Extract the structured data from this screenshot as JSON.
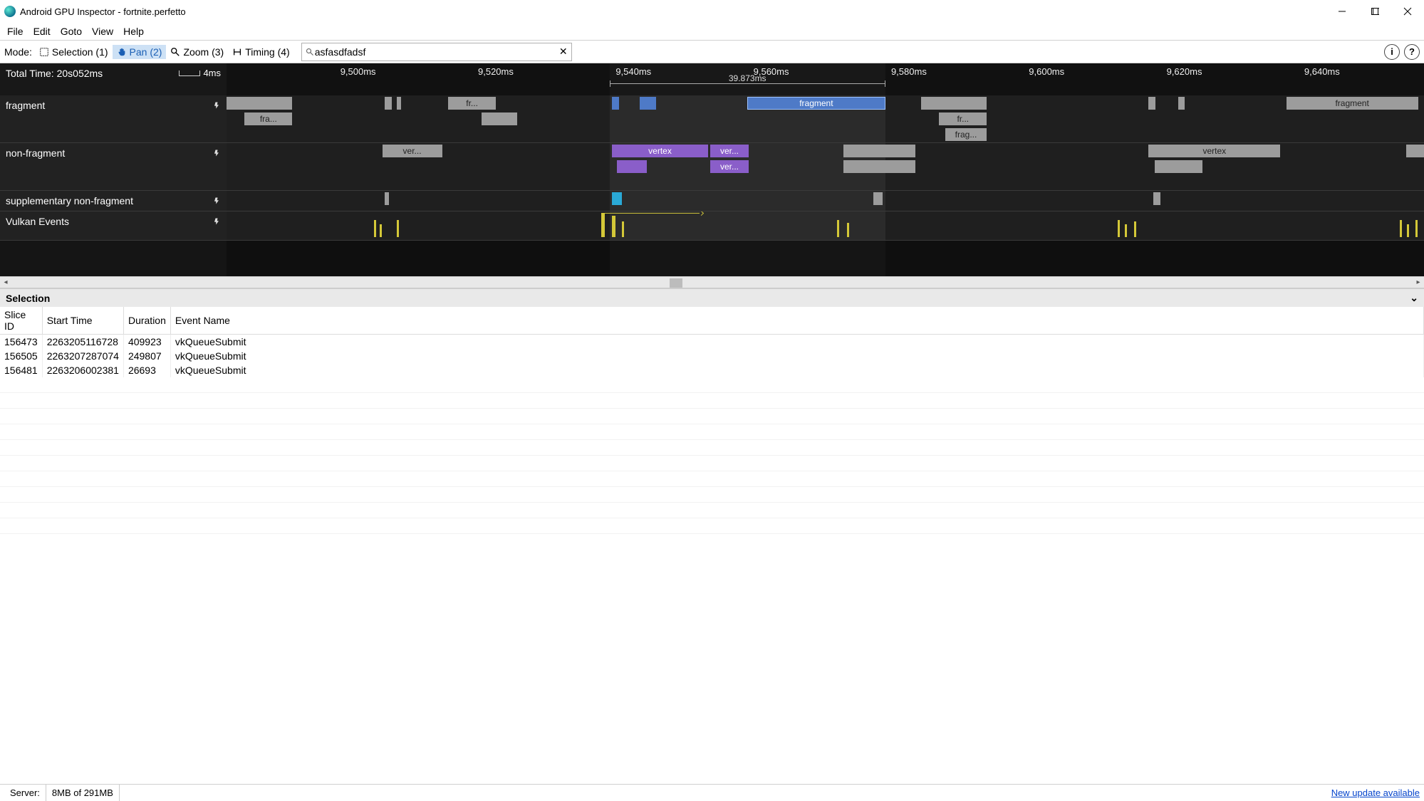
{
  "window": {
    "title": "Android GPU Inspector - fortnite.perfetto"
  },
  "menu": {
    "items": [
      "File",
      "Edit",
      "Goto",
      "View",
      "Help"
    ]
  },
  "toolbar": {
    "mode_label": "Mode:",
    "modes": {
      "selection": "Selection (1)",
      "pan": "Pan (2)",
      "zoom": "Zoom (3)",
      "timing": "Timing (4)"
    },
    "search_value": "asfasdfadsf"
  },
  "timeline": {
    "total_time_label": "Total Time: 20s052ms",
    "scale_label": "4ms",
    "ruler_ticks": [
      "9,500ms",
      "9,520ms",
      "9,540ms",
      "9,560ms",
      "9,580ms",
      "9,600ms",
      "9,620ms",
      "9,640ms"
    ],
    "selection_span_label": "39.873ms",
    "tracks": {
      "fragment": {
        "label": "fragment",
        "labels": {
          "fra": "fra...",
          "fr_short": "fr...",
          "fragment": "fragment",
          "frag": "frag..."
        }
      },
      "nonfragment": {
        "label": "non-fragment",
        "labels": {
          "ver": "ver...",
          "vertex": "vertex"
        }
      },
      "supplementary": {
        "label": "supplementary non-fragment"
      },
      "vulkan": {
        "label": "Vulkan Events"
      }
    }
  },
  "selection_panel": {
    "title": "Selection",
    "columns": [
      "Slice ID",
      "Start Time",
      "Duration",
      "Event Name"
    ],
    "rows": [
      {
        "slice_id": "156473",
        "start_time": "2263205116728",
        "duration": "409923",
        "event_name": "vkQueueSubmit"
      },
      {
        "slice_id": "156505",
        "start_time": "2263207287074",
        "duration": "249807",
        "event_name": "vkQueueSubmit"
      },
      {
        "slice_id": "156481",
        "start_time": "2263206002381",
        "duration": "26693",
        "event_name": "vkQueueSubmit"
      }
    ]
  },
  "status": {
    "server_label": "Server:",
    "memory": "8MB of 291MB",
    "update_link": "New update available"
  }
}
